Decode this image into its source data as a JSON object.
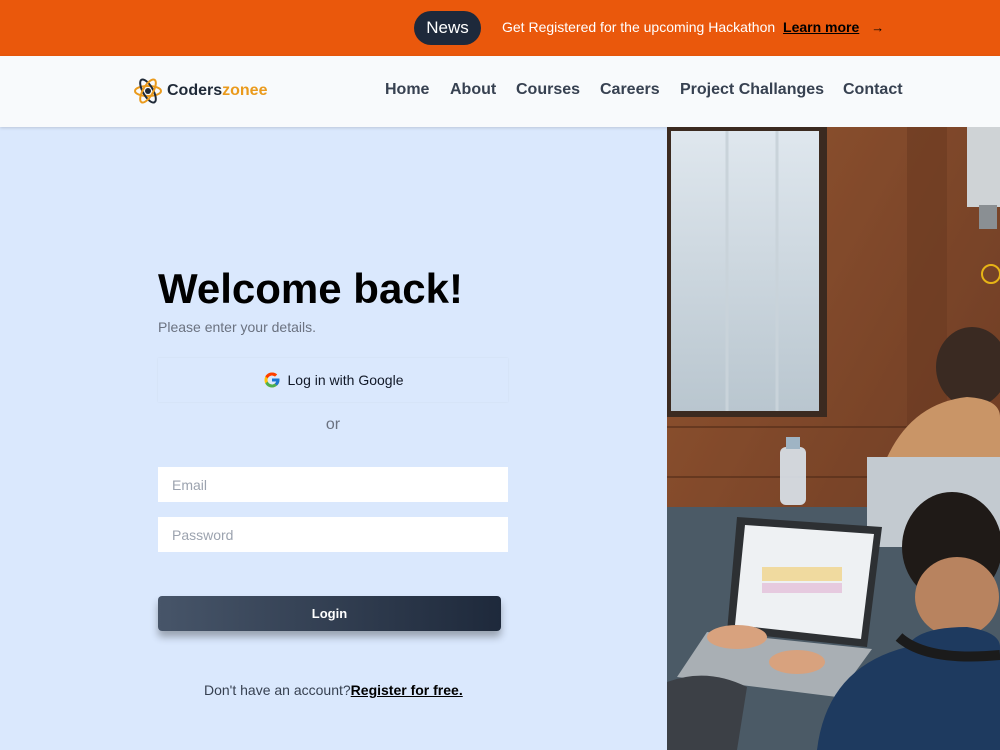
{
  "announcement": {
    "badge": "News",
    "text": "Get Registered for the upcoming Hackathon",
    "link": "Learn more",
    "arrow": "→"
  },
  "header": {
    "brand_main": "Coders",
    "brand_accent": "zonee",
    "nav": [
      {
        "label": "Home"
      },
      {
        "label": "About"
      },
      {
        "label": "Courses"
      },
      {
        "label": "Careers"
      },
      {
        "label": "Project Challanges"
      },
      {
        "label": "Contact"
      }
    ]
  },
  "login": {
    "title": "Welcome back!",
    "subtitle": "Please enter your details.",
    "google_label": "Log in with Google",
    "divider": "or",
    "email_placeholder": "Email",
    "password_placeholder": "Password",
    "submit_label": "Login",
    "register_prompt": "Don't have an account?",
    "register_link": "Register for free."
  },
  "colors": {
    "brand_orange": "#ea580c",
    "logo_accent": "#ea9a1c",
    "page_bg": "#dae8fd",
    "dark": "#1e293b"
  },
  "icons": {
    "logo": "atom-icon",
    "google": "google-icon",
    "arrow": "arrow-right-icon"
  }
}
